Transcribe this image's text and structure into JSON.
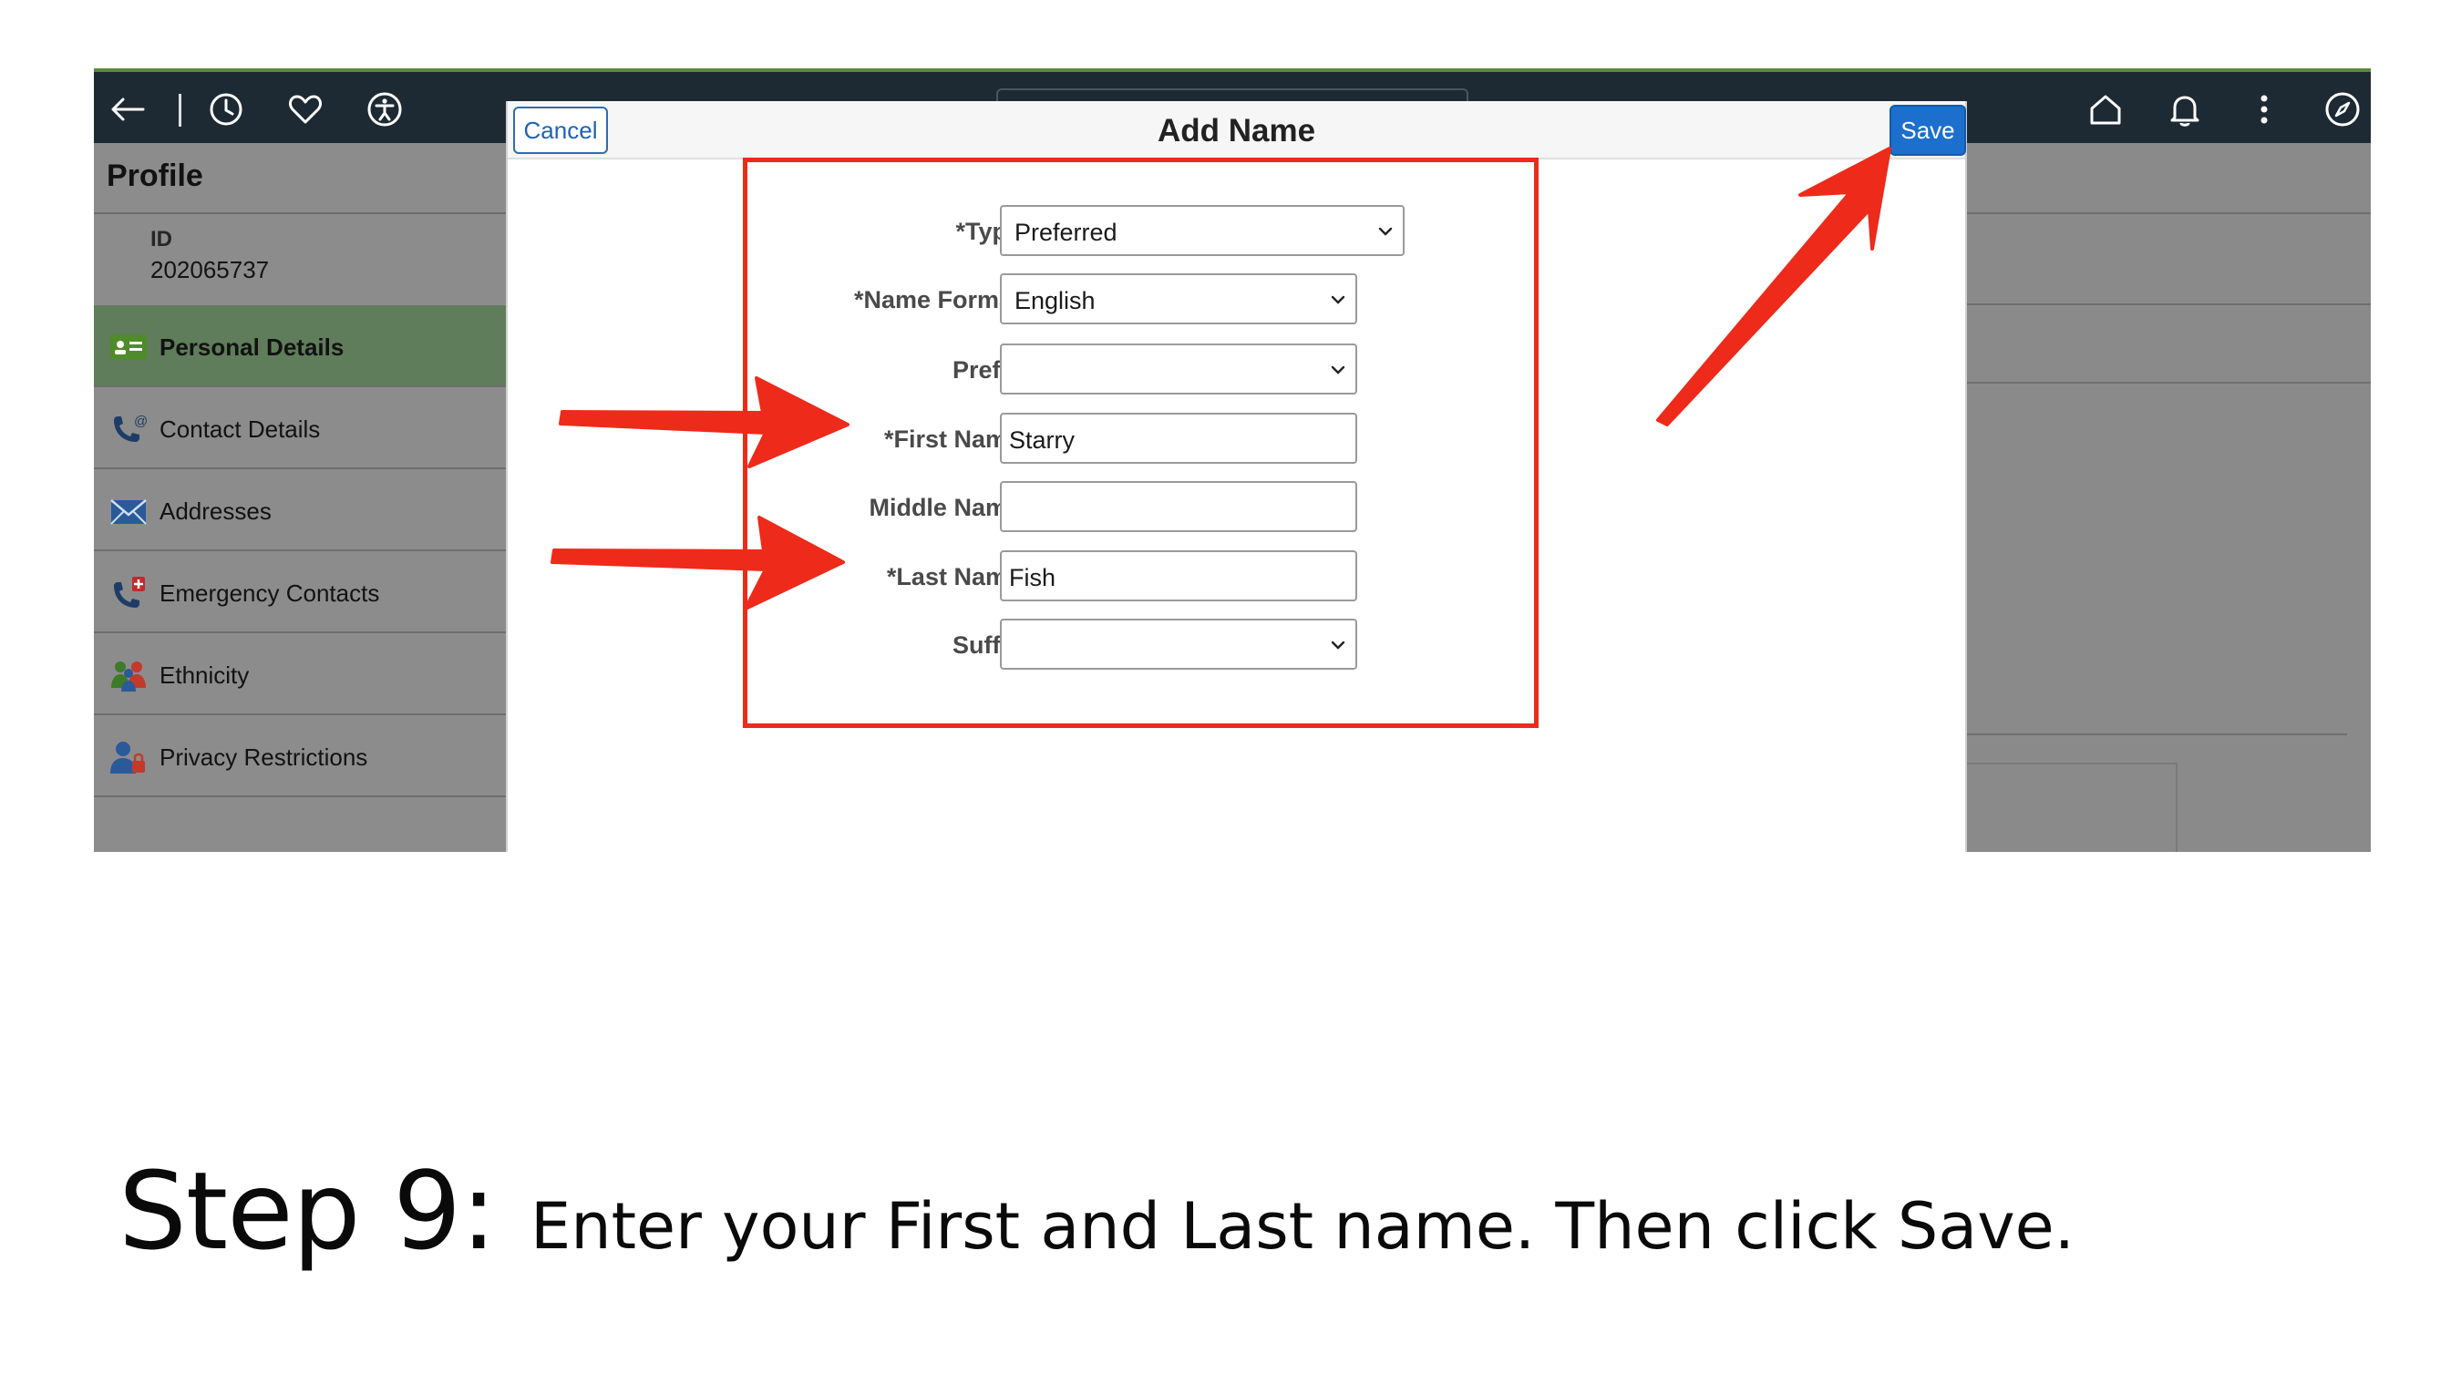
{
  "topbar": {
    "icons": [
      "back-arrow-icon",
      "history-clock-icon",
      "favorites-heart-icon",
      "accessibility-icon",
      "home-icon",
      "bell-icon",
      "more-vertical-icon",
      "compass-icon"
    ]
  },
  "profile": {
    "title": "Profile",
    "id_label": "ID",
    "id_value": "202065737",
    "nav": [
      {
        "label": "Personal Details",
        "icon": "id-card-icon",
        "active": true
      },
      {
        "label": "Contact Details",
        "icon": "phone-email-icon",
        "active": false
      },
      {
        "label": "Addresses",
        "icon": "envelope-icon",
        "active": false
      },
      {
        "label": "Emergency Contacts",
        "icon": "phone-emergency-icon",
        "active": false
      },
      {
        "label": "Ethnicity",
        "icon": "people-icon",
        "active": false
      },
      {
        "label": "Privacy Restrictions",
        "icon": "person-lock-icon",
        "active": false
      }
    ]
  },
  "modal": {
    "title": "Add Name",
    "cancel_label": "Cancel",
    "save_label": "Save",
    "fields": {
      "type": {
        "label": "*Type",
        "value": "Preferred"
      },
      "name_format": {
        "label": "*Name Format",
        "value": "English"
      },
      "prefix": {
        "label": "Prefix",
        "value": ""
      },
      "first_name": {
        "label": "*First Name",
        "value": "Starry"
      },
      "middle_name": {
        "label": "Middle Name",
        "value": ""
      },
      "last_name": {
        "label": "*Last Name",
        "value": "Fish"
      },
      "suffix": {
        "label": "Suffix",
        "value": ""
      }
    }
  },
  "caption": {
    "step": "Step 9:",
    "text": "Enter your First and Last name. Then click ",
    "bold": "Save",
    "end": "."
  },
  "colors": {
    "annotation_red": "#ee2a1b",
    "save_blue": "#1c6fcc",
    "active_nav_green": "#5f7d5a",
    "topbar_dark": "#1e2a33"
  }
}
